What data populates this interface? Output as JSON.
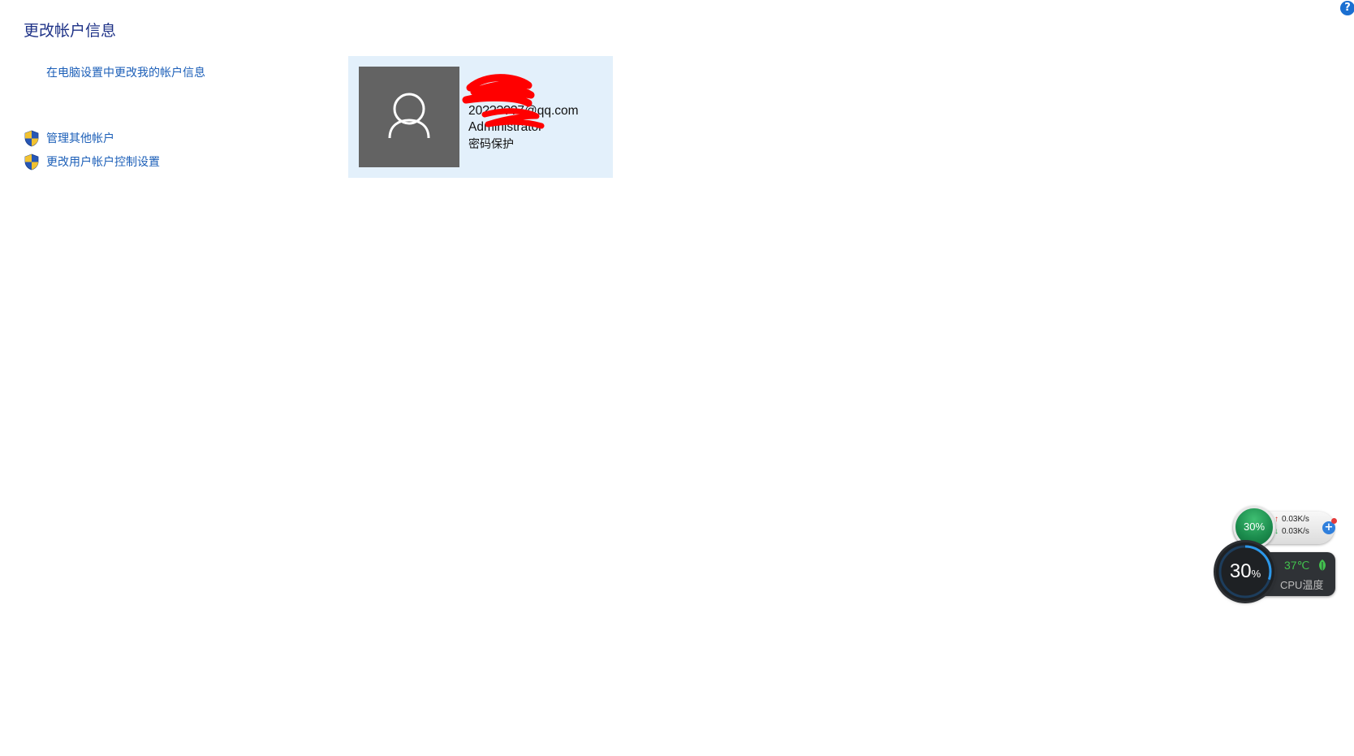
{
  "page": {
    "title": "更改帐户信息",
    "help_icon": "question-mark-icon"
  },
  "links": {
    "pc_settings": "在电脑设置中更改我的帐户信息"
  },
  "tasks": [
    {
      "label": "管理其他帐户",
      "icon": "uac-shield-icon"
    },
    {
      "label": "更改用户帐户控制设置",
      "icon": "uac-shield-icon"
    }
  ],
  "account": {
    "email": "20?????7@qq.com",
    "role": "Administrator",
    "protection": "密码保护",
    "avatar_icon": "user-silhouette-icon",
    "colors": {
      "card_bg": "#e3f0fb",
      "avatar_bg": "#636363",
      "redaction": "#ff0000"
    }
  },
  "widgets": {
    "memory_percent": "30%",
    "upload_speed": "0.03K/s",
    "download_speed": "0.03K/s",
    "cpu_value": "30",
    "cpu_unit": "%",
    "cpu_load_fraction": 0.3,
    "cpu_temp": "37℃",
    "cpu_temp_label": "CPU温度"
  },
  "colors": {
    "title": "#1e3287",
    "link": "#1c5fb8",
    "accent": "#1a6fd1"
  }
}
